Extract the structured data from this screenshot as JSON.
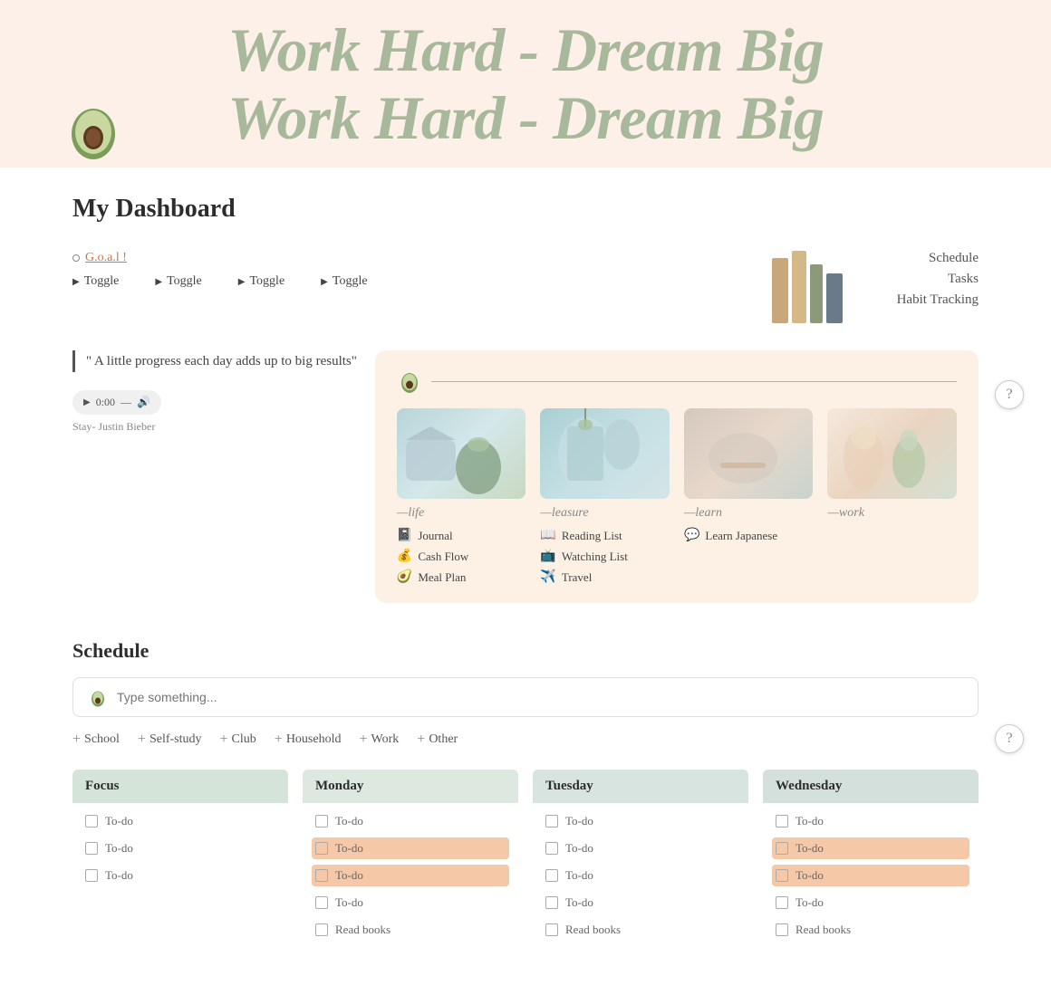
{
  "header": {
    "banner_line1": "Work Hard - Dream Big",
    "banner_line2": "Work Hard - Dream Big"
  },
  "dashboard": {
    "title": "My Dashboard",
    "goal_label": "G.o.a.l !",
    "toggles": [
      "Toggle",
      "Toggle",
      "Toggle",
      "Toggle"
    ],
    "side_links": [
      "Schedule",
      "Tasks",
      "Habit Tracking"
    ],
    "quote": "\" A little progress each day adds up to big results\"",
    "audio_time": "0:00",
    "song_credit": "Stay- Justin Bieber",
    "categories": [
      {
        "id": "life",
        "label": "—life",
        "links": [
          {
            "icon": "📓",
            "text": "Journal"
          },
          {
            "icon": "💰",
            "text": "Cash Flow"
          },
          {
            "icon": "🥑",
            "text": "Meal Plan"
          }
        ]
      },
      {
        "id": "leasure",
        "label": "—leasure",
        "links": [
          {
            "icon": "📖",
            "text": "Reading List"
          },
          {
            "icon": "📺",
            "text": "Watching List"
          },
          {
            "icon": "✈️",
            "text": "Travel"
          }
        ]
      },
      {
        "id": "learn",
        "label": "—learn",
        "links": [
          {
            "icon": "💬",
            "text": "Learn Japanese"
          }
        ]
      },
      {
        "id": "work",
        "label": "—work",
        "links": []
      }
    ]
  },
  "schedule": {
    "title": "Schedule",
    "input_placeholder": "Type something...",
    "tags": [
      "School",
      "Self-study",
      "Club",
      "Household",
      "Work",
      "Other"
    ],
    "columns": [
      {
        "label": "Focus",
        "color": "focus",
        "items": [
          {
            "text": "To-do",
            "highlighted": false
          },
          {
            "text": "To-do",
            "highlighted": false
          },
          {
            "text": "To-do",
            "highlighted": false
          }
        ]
      },
      {
        "label": "Monday",
        "color": "monday",
        "items": [
          {
            "text": "To-do",
            "highlighted": false
          },
          {
            "text": "To-do",
            "highlighted": true
          },
          {
            "text": "To-do",
            "highlighted": true
          },
          {
            "text": "To-do",
            "highlighted": false
          },
          {
            "text": "Read books",
            "highlighted": false
          }
        ]
      },
      {
        "label": "Tuesday",
        "color": "tuesday",
        "items": [
          {
            "text": "To-do",
            "highlighted": false
          },
          {
            "text": "To-do",
            "highlighted": false
          },
          {
            "text": "To-do",
            "highlighted": false
          },
          {
            "text": "To-do",
            "highlighted": false
          },
          {
            "text": "Read books",
            "highlighted": false
          }
        ]
      },
      {
        "label": "Wednesday",
        "color": "wednesday",
        "items": [
          {
            "text": "To-do",
            "highlighted": false
          },
          {
            "text": "To-do",
            "highlighted": true
          },
          {
            "text": "To-do",
            "highlighted": true
          },
          {
            "text": "To-do",
            "highlighted": false
          },
          {
            "text": "Read books",
            "highlighted": false
          }
        ]
      }
    ]
  },
  "help": {
    "label": "?"
  }
}
